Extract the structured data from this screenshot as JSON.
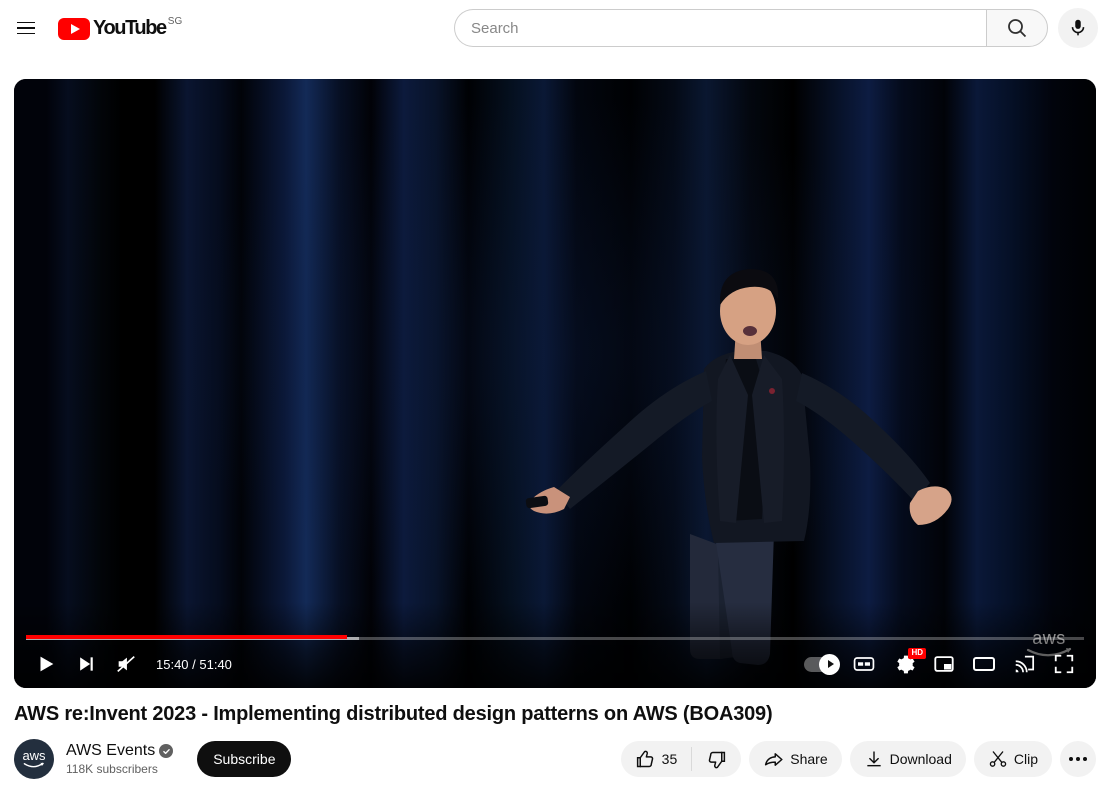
{
  "masthead": {
    "menu_label": "Guide",
    "logo_text": "YouTube",
    "country_code": "SG",
    "search": {
      "value": "",
      "placeholder": "Search",
      "search_button_label": "Search",
      "mic_button_label": "Search with your voice"
    }
  },
  "player": {
    "watermark": "aws",
    "progress": {
      "played_percent": 30.3,
      "buffered_percent": 31.5
    },
    "controls": {
      "play_label": "Play",
      "next_label": "Next",
      "mute_label": "Unmute",
      "time_current": "15:40",
      "time_separator": " / ",
      "time_total": "51:40",
      "time_display": "15:40 / 51:40",
      "autoplay_label": "Autoplay is on",
      "autoplay_on": true,
      "subtitles_label": "Subtitles/closed captions",
      "settings_label": "Settings",
      "quality_badge": "HD",
      "miniplayer_label": "Miniplayer",
      "theater_label": "Theater mode",
      "cast_label": "Play on TV",
      "fullscreen_label": "Full screen"
    }
  },
  "video": {
    "title": "AWS re:Invent 2023 - Implementing distributed design patterns on AWS (BOA309)",
    "channel": {
      "avatar_text": "aws",
      "name": "AWS Events",
      "verified": true,
      "subscribers": "118K subscribers",
      "subscribe_label": "Subscribe"
    },
    "actions": {
      "like_count": "35",
      "like_label": "like this video along with 35 other people",
      "dislike_label": "Dislike this video",
      "share_label": "Share",
      "download_label": "Download",
      "clip_label": "Clip",
      "more_label": "More actions"
    }
  },
  "colors": {
    "brand_red": "#ff0000",
    "progress_red": "#ff0000",
    "text_primary": "#0f0f0f",
    "text_secondary": "#606060",
    "chip_bg": "#f2f2f2",
    "subscribe_bg": "#0f0f0f",
    "avatar_bg": "#232f3e"
  }
}
